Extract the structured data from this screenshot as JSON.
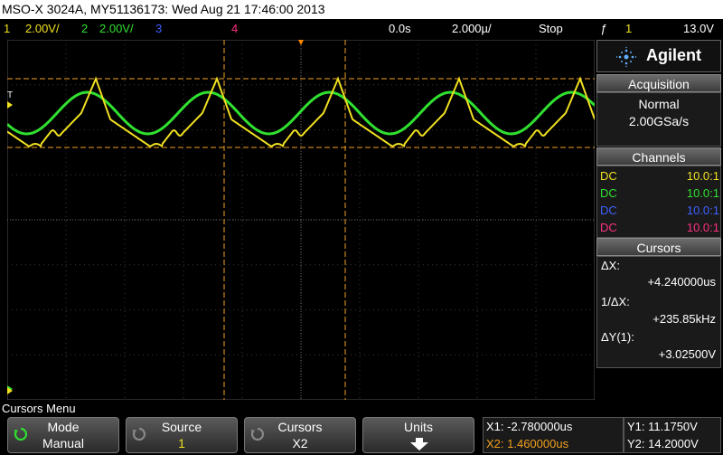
{
  "title": "MSO-X 3024A, MY51136173: Wed Aug 21 17:46:00 2013",
  "status": {
    "ch1_num": "1",
    "ch1_scale": "2.00V/",
    "ch2_num": "2",
    "ch2_scale": "2.00V/",
    "ch3_num": "3",
    "ch4_num": "4",
    "delay": "0.0s",
    "timebase": "2.000µ/",
    "run_state": "Stop",
    "trig_icon": "ƒ",
    "trig_source": "1",
    "trig_level": "13.0V"
  },
  "brand": "Agilent",
  "acquisition": {
    "header": "Acquisition",
    "mode": "Normal",
    "rate": "2.00GSa/s"
  },
  "channels": {
    "header": "Channels",
    "rows": [
      {
        "coupling": "DC",
        "probe": "10.0:1",
        "color": "#f0e020"
      },
      {
        "coupling": "DC",
        "probe": "10.0:1",
        "color": "#30e030"
      },
      {
        "coupling": "DC",
        "probe": "10.0:1",
        "color": "#4060ff"
      },
      {
        "coupling": "DC",
        "probe": "10.0:1",
        "color": "#ff3080"
      }
    ]
  },
  "cursors": {
    "header": "Cursors",
    "dx_label": "ΔX:",
    "dx_value": "+4.240000us",
    "inv_label": "1/ΔX:",
    "inv_value": "+235.85kHz",
    "dy_label": "ΔY(1):",
    "dy_value": "+3.02500V"
  },
  "menu_title": "Cursors Menu",
  "softkeys": {
    "mode": {
      "label": "Mode",
      "value": "Manual"
    },
    "source": {
      "label": "Source",
      "value": "1"
    },
    "cursors": {
      "label": "Cursors",
      "value": "X2"
    },
    "units": {
      "label": "Units"
    }
  },
  "readouts": {
    "x1": "X1: -2.780000us",
    "x2": "X2: 1.460000us",
    "y1": "Y1: 11.1750V",
    "y2": "Y2: 14.2000V"
  },
  "colors": {
    "ch1": "#f0e020",
    "ch2": "#30e030",
    "ch3": "#4060ff",
    "ch4": "#ff3080",
    "cursor": "#f0a020",
    "trigger_marker": "#ff8800"
  }
}
